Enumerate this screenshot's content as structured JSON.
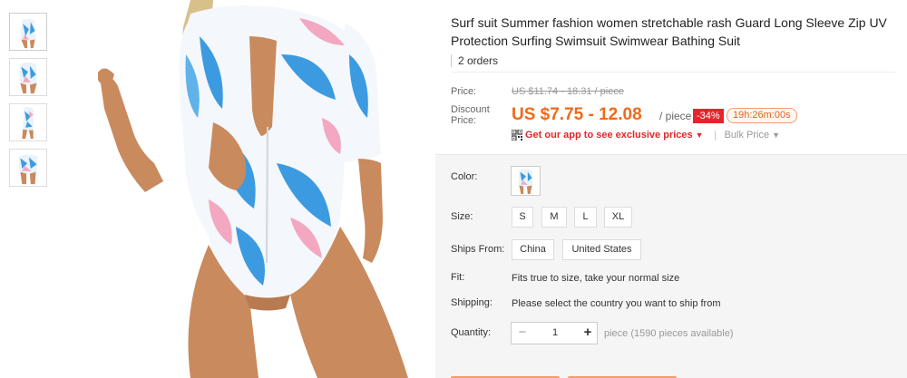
{
  "thumbnails": [
    {
      "label": ""
    },
    {
      "label": ""
    },
    {
      "label": ""
    },
    {
      "label": ""
    }
  ],
  "product": {
    "title": "Surf suit Summer fashion women stretchable rash Guard Long Sleeve Zip UV Protection Surfing Swimsuit Swimwear Bathing Suit",
    "orders": "2 orders"
  },
  "pricing": {
    "price_label": "Price:",
    "original_price": "US $11.74 - 18.31 / piece",
    "discount_label": "Discount Price:",
    "discount_price": "US $7.75 - 12.08",
    "per_piece": "/ piece",
    "discount_badge": "-34%",
    "countdown": "19h:26m:00s",
    "app_promo": "Get our app to see exclusive prices",
    "bulk_price": "Bulk Price"
  },
  "attributes": {
    "color_label": "Color:",
    "size_label": "Size:",
    "sizes": [
      "S",
      "M",
      "L",
      "XL"
    ],
    "ships_from_label": "Ships From:",
    "ships_from": [
      "China",
      "United States"
    ],
    "fit_label": "Fit:",
    "fit_text": "Fits true to size, take your normal size",
    "shipping_label": "Shipping:",
    "shipping_text": "Please select the country you want to ship from",
    "quantity_label": "Quantity:",
    "quantity_value": "1",
    "quantity_minus": "−",
    "quantity_plus": "+",
    "quantity_available": "piece (1590 pieces available)"
  },
  "colors": {
    "accent": "#ee6a1a",
    "badge": "#e4262c",
    "swimsuit_base": "#f4f7fb",
    "leaf_blue": "#3c9be0",
    "leaf_pink": "#f3a7c0",
    "skin": "#c98a5e"
  }
}
